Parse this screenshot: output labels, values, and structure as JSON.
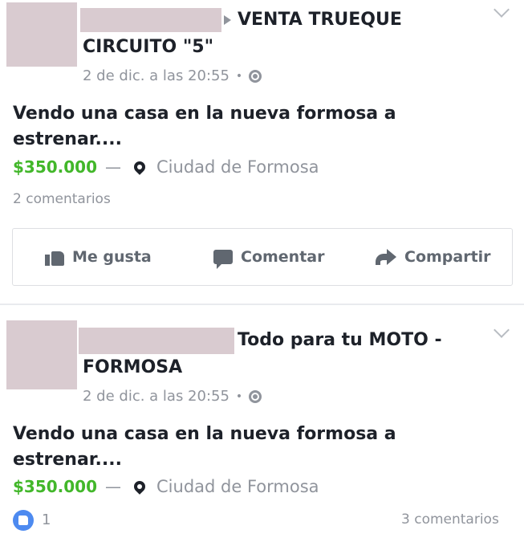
{
  "posts": [
    {
      "group_line1": "VENTA  TRUEQUE",
      "group_line2": "CIRCUITO \"5\"",
      "timestamp": "2 de dic. a las 20:55",
      "separator": "•",
      "title": "Vendo una casa en la nueva formosa a estrenar....",
      "price": "$350.000",
      "dash": "—",
      "location": "Ciudad de Formosa",
      "comments": "2 comentarios",
      "actions": {
        "like": "Me gusta",
        "comment": "Comentar",
        "share": "Compartir"
      }
    },
    {
      "group_line1": "Todo para tu MOTO -",
      "group_line2": "FORMOSA",
      "timestamp": "2 de dic. a las 20:55",
      "separator": "•",
      "title": "Vendo una casa en la nueva formosa a estrenar....",
      "price": "$350.000",
      "dash": "—",
      "location": "Ciudad de Formosa",
      "likes": "1",
      "comments": "3 comentarios"
    }
  ],
  "colors": {
    "price": "#42b72a",
    "muted": "#90949c",
    "like_badge": "#4d8af0",
    "redaction": "#d9cbd0"
  },
  "icons": [
    "chevron-down-icon",
    "globe-icon",
    "location-pin-icon",
    "thumbs-up-icon",
    "comment-icon",
    "share-icon"
  ]
}
